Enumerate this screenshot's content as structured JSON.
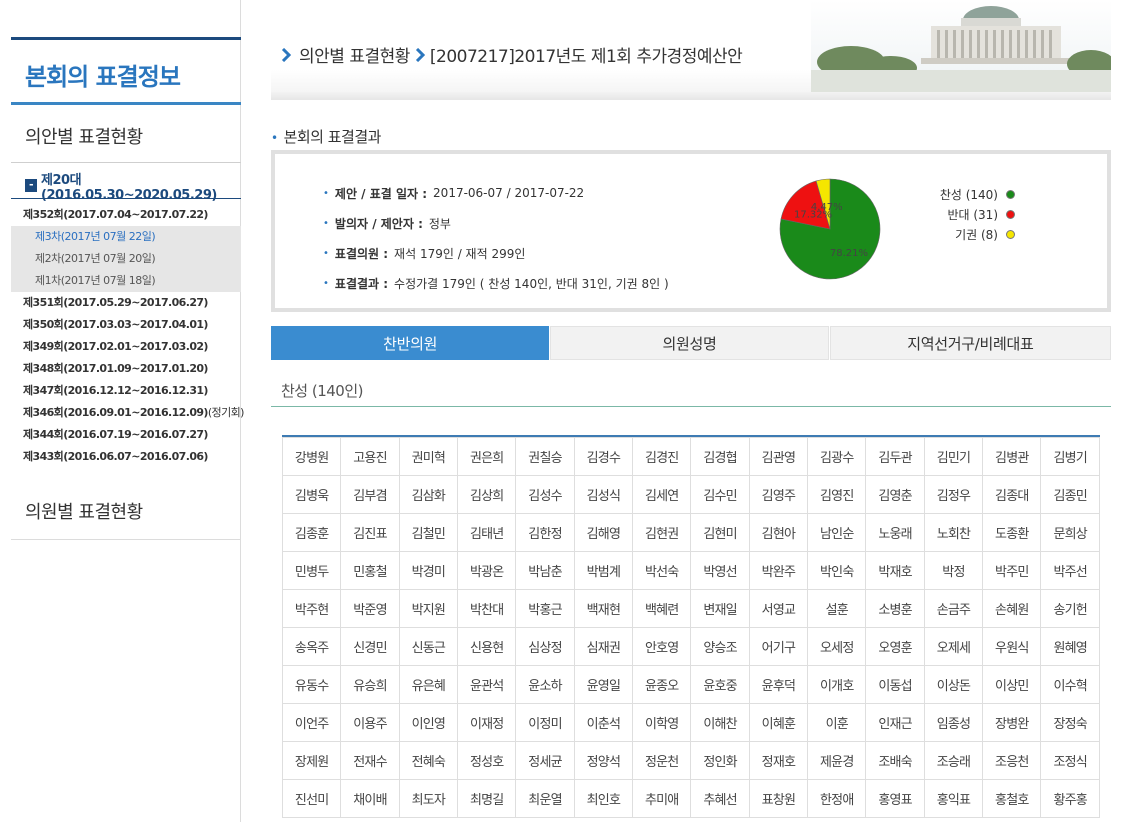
{
  "sidebar": {
    "title": "본회의 표결정보",
    "menu": [
      "의안별 표결현황",
      "의원별 표결현황"
    ],
    "term": "제20대(2016.05.30~2020.05.29)",
    "sessions": [
      {
        "label": "제352회(2017.07.04~2017.07.22)",
        "extra": "",
        "sittings": [
          {
            "label": "제3차(2017년 07월 22일)",
            "active": true
          },
          {
            "label": "제2차(2017년 07월 20일)",
            "active": false
          },
          {
            "label": "제1차(2017년 07월 18일)",
            "active": false
          }
        ]
      },
      {
        "label": "제351회(2017.05.29~2017.06.27)",
        "extra": "",
        "sittings": []
      },
      {
        "label": "제350회(2017.03.03~2017.04.01)",
        "extra": "",
        "sittings": []
      },
      {
        "label": "제349회(2017.02.01~2017.03.02)",
        "extra": "",
        "sittings": []
      },
      {
        "label": "제348회(2017.01.09~2017.01.20)",
        "extra": "",
        "sittings": []
      },
      {
        "label": "제347회(2016.12.12~2016.12.31)",
        "extra": "",
        "sittings": []
      },
      {
        "label": "제346회(2016.09.01~2016.12.09)",
        "extra": "(정기회)",
        "sittings": []
      },
      {
        "label": "제344회(2016.07.19~2016.07.27)",
        "extra": "",
        "sittings": []
      },
      {
        "label": "제343회(2016.06.07~2016.07.06)",
        "extra": "",
        "sittings": []
      }
    ]
  },
  "breadcrumb": {
    "section": "의안별 표결현황",
    "bill": "[2007217]2017년도 제1회 추가경정예산안"
  },
  "result": {
    "section_title": "본회의 표결결과",
    "rows": [
      {
        "label": "제안 / 표결 일자 :",
        "value": "2017-06-07 / 2017-07-22"
      },
      {
        "label": "발의자 / 제안자 :",
        "value": "정부"
      },
      {
        "label": "표결의원 :",
        "value": "재석 179인 / 재적 299인"
      },
      {
        "label": "표결결과 :",
        "value": "수정가결 179인 ( 찬성 140인, 반대 31인, 기권 8인 )"
      }
    ]
  },
  "chart_data": {
    "type": "pie",
    "slices": [
      {
        "label": "찬성",
        "value": 140,
        "percent": "78.21%",
        "color": "#1a8a1a"
      },
      {
        "label": "반대",
        "value": 31,
        "percent": "17.32%",
        "color": "#ee1111"
      },
      {
        "label": "기권",
        "value": 8,
        "percent": "4.47%",
        "color": "#f5e600"
      }
    ],
    "legend": [
      "찬성 (140)",
      "반대 (31)",
      "기권 (8)"
    ],
    "legend_position": "right"
  },
  "tabs": [
    {
      "label": "찬반의원",
      "active": true
    },
    {
      "label": "의원성명",
      "active": false
    },
    {
      "label": "지역선거구/비례대표",
      "active": false
    }
  ],
  "vote_label": "찬성 (140인)",
  "members": [
    [
      "강병원",
      "고용진",
      "권미혁",
      "권은희",
      "권칠승",
      "김경수",
      "김경진",
      "김경협",
      "김관영",
      "김광수",
      "김두관",
      "김민기",
      "김병관",
      "김병기"
    ],
    [
      "김병욱",
      "김부겸",
      "김삼화",
      "김상희",
      "김성수",
      "김성식",
      "김세연",
      "김수민",
      "김영주",
      "김영진",
      "김영춘",
      "김정우",
      "김종대",
      "김종민"
    ],
    [
      "김종훈",
      "김진표",
      "김철민",
      "김태년",
      "김한정",
      "김해영",
      "김현권",
      "김현미",
      "김현아",
      "남인순",
      "노웅래",
      "노회찬",
      "도종환",
      "문희상"
    ],
    [
      "민병두",
      "민홍철",
      "박경미",
      "박광온",
      "박남춘",
      "박범계",
      "박선숙",
      "박영선",
      "박완주",
      "박인숙",
      "박재호",
      "박정",
      "박주민",
      "박주선"
    ],
    [
      "박주현",
      "박준영",
      "박지원",
      "박찬대",
      "박홍근",
      "백재현",
      "백혜련",
      "변재일",
      "서영교",
      "설훈",
      "소병훈",
      "손금주",
      "손혜원",
      "송기헌"
    ],
    [
      "송옥주",
      "신경민",
      "신동근",
      "신용현",
      "심상정",
      "심재권",
      "안호영",
      "양승조",
      "어기구",
      "오세정",
      "오영훈",
      "오제세",
      "우원식",
      "원혜영"
    ],
    [
      "유동수",
      "유승희",
      "유은혜",
      "윤관석",
      "윤소하",
      "윤영일",
      "윤종오",
      "윤호중",
      "윤후덕",
      "이개호",
      "이동섭",
      "이상돈",
      "이상민",
      "이수혁"
    ],
    [
      "이언주",
      "이용주",
      "이인영",
      "이재정",
      "이정미",
      "이춘석",
      "이학영",
      "이해찬",
      "이혜훈",
      "이훈",
      "인재근",
      "임종성",
      "장병완",
      "장정숙"
    ],
    [
      "장제원",
      "전재수",
      "전혜숙",
      "정성호",
      "정세균",
      "정양석",
      "정운천",
      "정인화",
      "정재호",
      "제윤경",
      "조배숙",
      "조승래",
      "조응천",
      "조정식"
    ],
    [
      "진선미",
      "채이배",
      "최도자",
      "최명길",
      "최운열",
      "최인호",
      "추미애",
      "추혜선",
      "표창원",
      "한정애",
      "홍영표",
      "홍익표",
      "홍철호",
      "황주홍"
    ]
  ]
}
